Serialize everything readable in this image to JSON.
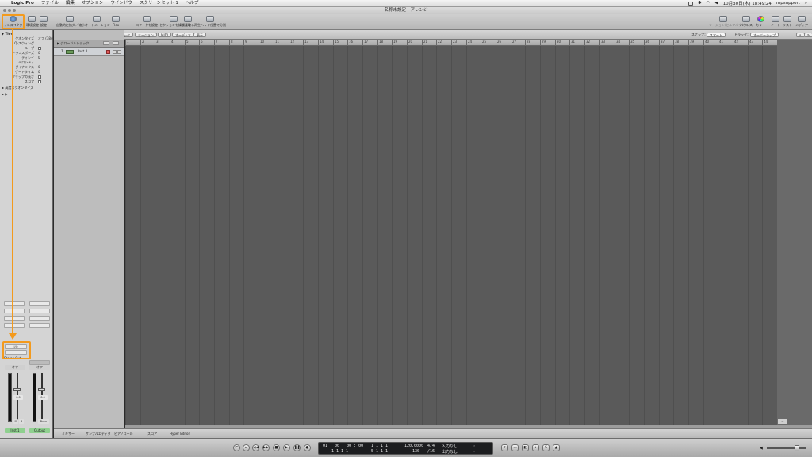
{
  "menubar": {
    "app": "Logic Pro",
    "items": [
      "ファイル",
      "編集",
      "オプション",
      "ウインドウ",
      "スクリーンセット 1",
      "ヘルプ"
    ],
    "clock": "10月30日(木) 18:49:24",
    "user": "mpsupport"
  },
  "window": {
    "title": "名称未設定 - アレンジ"
  },
  "toolbar": {
    "inspector": "インスペクタ",
    "settings": "環境設定",
    "setup": "設定",
    "autozoom": "自動的に拡大／縮小",
    "automation": "オートメーション",
    "flex": "Flex",
    "set_locators": "ロケータを設定",
    "repeat_section": "セクションを繰り返す",
    "split": "切り取る",
    "split_at_playhead": "再生ヘッド位置で分割",
    "bounce": "リージョン/セルフバウンス",
    "bounce_label": "バウンス",
    "colors": "カラー",
    "notes": "ノート",
    "lists": "リスト",
    "media": "メディア"
  },
  "inspector": {
    "section": "▼ Thru",
    "rows": [
      {
        "label": "クオンタイズ",
        "value": "オフ (3840)"
      },
      {
        "label": "Q-スウィング",
        "value": ""
      },
      {
        "label": "ループ",
        "value": ""
      },
      {
        "label": "トランスポーズ",
        "value": "0"
      },
      {
        "label": "ディレイ",
        "value": "0"
      },
      {
        "label": "ベロシティ",
        "value": ""
      },
      {
        "label": "ダイナミクス",
        "value": "0"
      },
      {
        "label": "ゲートタイム",
        "value": "0"
      },
      {
        "label": "クリップの長さ",
        "value": ""
      },
      {
        "label": "スコア",
        "value": ""
      }
    ],
    "more_label": "▶ 高度なクオンタイズ",
    "strip_left_name": "Inst 1",
    "strip_right_name": "Output",
    "io_label": "I/O",
    "stereo_out": "Stereo Out",
    "off_left": "オフ",
    "off_right": "オフ",
    "gain_left": "0.0",
    "gain_right": "0.0",
    "mute_left": "M",
    "solo_left": "S",
    "bnce": "Bnce"
  },
  "arrange_toolbar": {
    "edit": "編集",
    "track": "トラック",
    "region": "リージョン",
    "midi": "MIDI",
    "audio": "オーディオ",
    "view": "表示",
    "snap_label": "スナップ：",
    "snap_value": "スマート",
    "drag_label": "ドラッグ：",
    "drag_value": "オーバーラップ"
  },
  "tracklist": {
    "global_tracks": "▶ グローバルトラック",
    "tracks": [
      {
        "number": "1",
        "name": "Inst 1"
      }
    ]
  },
  "ruler": {
    "bars": [
      "1",
      "2",
      "3",
      "4",
      "5",
      "6",
      "7",
      "8",
      "9",
      "10",
      "11",
      "12",
      "13",
      "14",
      "15",
      "16",
      "17",
      "18",
      "19",
      "20",
      "21",
      "22",
      "23",
      "24",
      "25",
      "26",
      "27",
      "28",
      "29",
      "30",
      "31",
      "32",
      "33",
      "34",
      "35",
      "36",
      "37",
      "38",
      "39",
      "40",
      "41",
      "42",
      "43",
      "44"
    ]
  },
  "bottom_tabs": [
    "ミキサー",
    "サンプルエディタ",
    "ピアノロール",
    "スコア",
    "Hyper Editor"
  ],
  "transport": {
    "time": "01 : 00 : 00 : 00",
    "time_sub": "1     1     1     1",
    "position": "1   1   1   1",
    "position_sub": "5   1   1   1",
    "tempo": "120.0000",
    "tempo_sub": "130",
    "signature": "4/4",
    "division": "/16",
    "in_label": "入力なし",
    "out_label": "出力なし"
  },
  "colors": {
    "highlight": "#f39a1d",
    "arrange_bg": "#5a5a5a"
  }
}
